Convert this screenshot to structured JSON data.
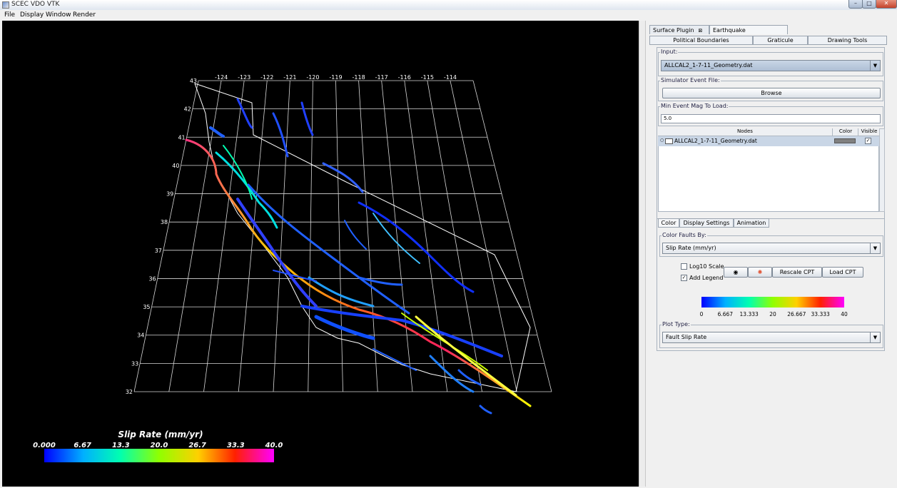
{
  "window": {
    "title": "SCEC VDO VTK"
  },
  "menu": [
    "File",
    "Display",
    "Window",
    "Render"
  ],
  "plugin_tabs": [
    {
      "label": "Surface Plugin",
      "closable": true
    },
    {
      "label": "Earthquake Simulators",
      "closable": true
    }
  ],
  "sub_tabs": [
    "Political Boundaries",
    "Graticule",
    "Drawing Tools"
  ],
  "input": {
    "legend": "Input:",
    "value": "ALLCAL2_1-7-11_Geometry.dat"
  },
  "event_file": {
    "legend": "Simulator Event File:",
    "browse_label": "Browse"
  },
  "min_mag": {
    "legend": "Min Event Mag To Load:",
    "value": "5.0"
  },
  "nodes_table": {
    "headers": [
      "Nodes",
      "Color",
      "Visible"
    ],
    "rows": [
      {
        "name": "ALLCAL2_1-7-11_Geometry.dat",
        "color": "#808080",
        "visible": true
      }
    ]
  },
  "settings_tabs": [
    "Color",
    "Display Settings",
    "Animation"
  ],
  "color_by": {
    "legend": "Color Faults By:",
    "value": "Slip Rate (mm/yr)"
  },
  "log10": {
    "label": "Log10 Scale",
    "checked": false
  },
  "add_legend": {
    "label": "Add Legend",
    "checked": true
  },
  "cpt_buttons": {
    "rescale": "Rescale CPT",
    "load": "Load CPT"
  },
  "panel_colorbar": {
    "ticks": [
      "0",
      "6.667",
      "13.333",
      "20",
      "26.667",
      "33.333",
      "40"
    ]
  },
  "plot_type": {
    "legend": "Plot Type:",
    "value": "Fault Slip Rate"
  },
  "viewport_legend": {
    "title": "Slip Rate (mm/yr)",
    "ticks": [
      "0.000",
      "6.67",
      "13.3",
      "20.0",
      "26.7",
      "33.3",
      "40.0"
    ]
  },
  "graticule": {
    "lon_labels": [
      "-124",
      "-123",
      "-122",
      "-121",
      "-120",
      "-119",
      "-118",
      "-117",
      "-116",
      "-115",
      "-114"
    ],
    "lat_labels": [
      "43",
      "42",
      "41",
      "40",
      "39",
      "38",
      "37",
      "36",
      "35",
      "34",
      "33",
      "32"
    ]
  },
  "colors": {
    "viewport_bg": "#000000",
    "ramp": [
      "#0000ff",
      "#00ffff",
      "#00ff00",
      "#ffff00",
      "#ff0000",
      "#ff00ff"
    ]
  },
  "icons": [
    "app-icon",
    "minimize-icon",
    "maximize-icon",
    "close-icon",
    "eye-icon",
    "color-wheel-icon",
    "folder-icon",
    "dropdown-arrow-icon"
  ]
}
